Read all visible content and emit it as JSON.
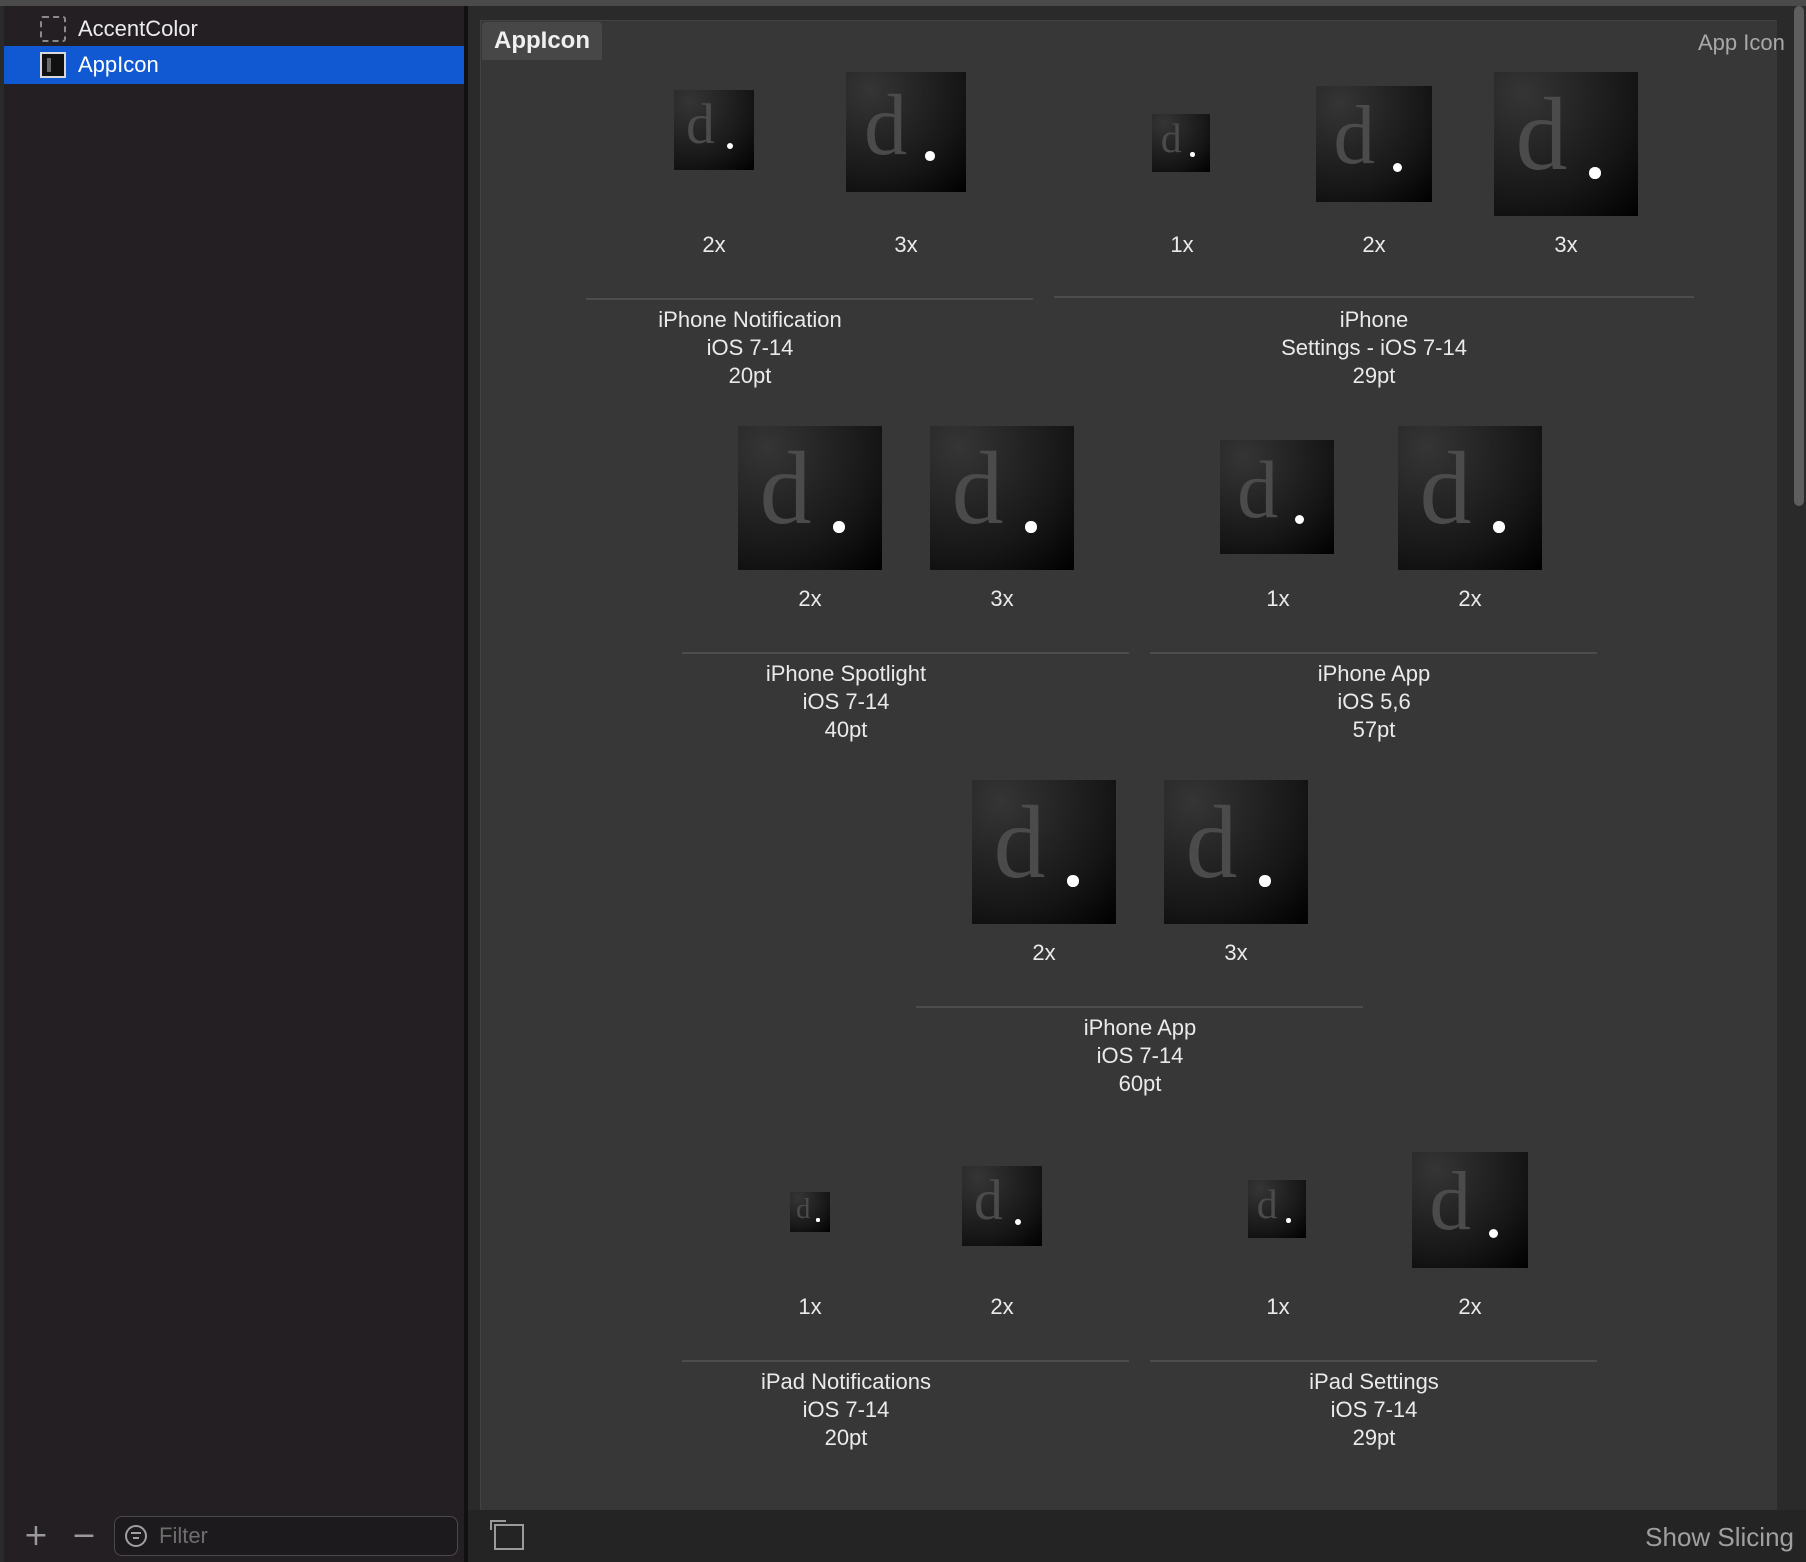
{
  "sidebar": {
    "items": [
      {
        "label": "AccentColor",
        "icon": "color-set-icon",
        "selected": false
      },
      {
        "label": "AppIcon",
        "icon": "app-icon-set-icon",
        "selected": true
      }
    ],
    "add_label": "+",
    "remove_label": "−",
    "filter_placeholder": "Filter"
  },
  "editor": {
    "set_name": "AppIcon",
    "set_type_label": "App Icon",
    "icon_glyph": "d",
    "groups": [
      {
        "title": "iPhone Notification\niOS 7-14\n20pt",
        "scales": [
          "2x",
          "3x"
        ]
      },
      {
        "title": "iPhone\nSettings - iOS 7-14\n29pt",
        "scales": [
          "1x",
          "2x",
          "3x"
        ]
      },
      {
        "title": "iPhone Spotlight\niOS 7-14\n40pt",
        "scales": [
          "2x",
          "3x"
        ]
      },
      {
        "title": "iPhone App\niOS 5,6\n57pt",
        "scales": [
          "1x",
          "2x"
        ]
      },
      {
        "title": "iPhone App\niOS 7-14\n60pt",
        "scales": [
          "2x",
          "3x"
        ]
      },
      {
        "title": "iPad Notifications\niOS 7-14\n20pt",
        "scales": [
          "1x",
          "2x"
        ]
      },
      {
        "title": "iPad Settings\niOS 7-14\n29pt",
        "scales": [
          "1x",
          "2x"
        ]
      }
    ]
  },
  "bottom_bar": {
    "show_slicing_label": "Show Slicing"
  },
  "colors": {
    "selection": "#1059d3",
    "sidebar_bg": "#231f23",
    "canvas_bg": "#373737"
  }
}
